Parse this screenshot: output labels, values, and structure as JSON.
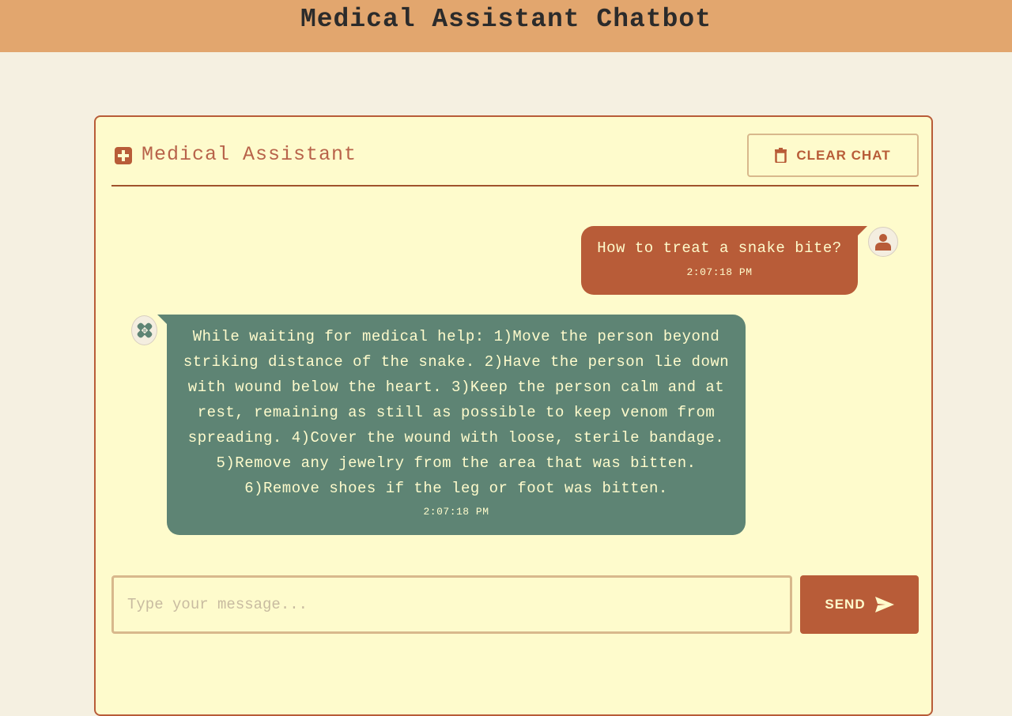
{
  "page": {
    "title": "Medical Assistant Chatbot"
  },
  "card": {
    "title": "Medical Assistant",
    "clear_label": "CLEAR CHAT"
  },
  "messages": [
    {
      "sender": "user",
      "text": "How to treat a snake bite?",
      "time": "2:07:18 PM"
    },
    {
      "sender": "bot",
      "text": "While waiting for medical help: 1)Move the person beyond striking distance of the snake. 2)Have the person lie down with wound below the heart. 3)Keep the person calm and at rest, remaining as still as possible to keep venom from spreading. 4)Cover the wound with loose, sterile bandage. 5)Remove any jewelry from the area that was bitten. 6)Remove shoes if the leg or foot was bitten.",
      "time": "2:07:18 PM"
    }
  ],
  "composer": {
    "placeholder": "Type your message...",
    "value": "",
    "send_label": "SEND"
  },
  "icons": {
    "header_icon": "medical-kit-icon",
    "clear_icon": "trash-icon",
    "user_avatar": "person-icon",
    "bot_avatar": "bandage-icon",
    "send_icon": "paper-plane-icon"
  },
  "colors": {
    "header_bg": "#e2a66e",
    "page_bg": "#f5f0e1",
    "card_bg": "#fefbcc",
    "accent": "#b85c38",
    "bot_bubble": "#5e8474",
    "bubble_text": "#fefbcc"
  }
}
